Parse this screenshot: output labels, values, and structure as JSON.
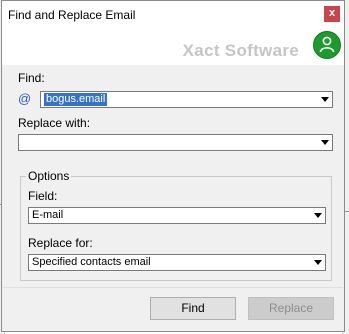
{
  "window": {
    "title": "Find and Replace Email",
    "close_glyph": "x"
  },
  "header": {
    "brand": "Xact Software",
    "user_icon": "user-icon"
  },
  "find": {
    "label": "Find:",
    "icon": "at-icon",
    "icon_glyph": "@",
    "value": "bogus.email"
  },
  "replace_with": {
    "label": "Replace with:",
    "value": ""
  },
  "options": {
    "legend": "Options",
    "field_label": "Field:",
    "field_value": "E-mail",
    "replace_for_label": "Replace for:",
    "replace_for_value": "Specified contacts email"
  },
  "buttons": {
    "find_label": "Find",
    "replace_label": "Replace",
    "replace_disabled": true
  },
  "colors": {
    "accent": "#3373c9",
    "user_icon_bg": "#1e9b2e",
    "close_bg": "#c8464b"
  }
}
